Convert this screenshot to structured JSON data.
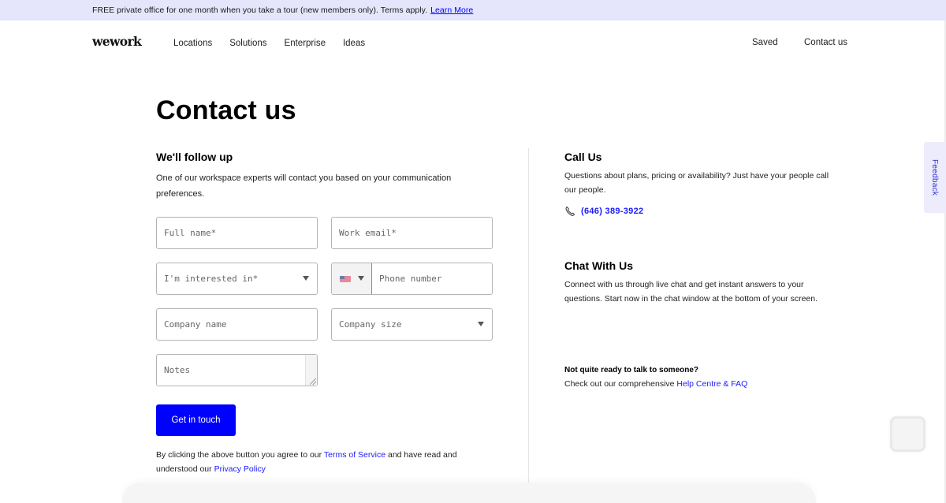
{
  "promo": {
    "text": "FREE private office for one month when you take a tour (new members only). Terms apply.",
    "link_label": "Learn More"
  },
  "nav": {
    "logo": "wework",
    "links": [
      {
        "label": "Locations"
      },
      {
        "label": "Solutions"
      },
      {
        "label": "Enterprise"
      },
      {
        "label": "Ideas"
      }
    ],
    "saved_label": "Saved",
    "contact_label": "Contact us"
  },
  "page": {
    "title": "Contact us"
  },
  "form": {
    "heading": "We'll follow up",
    "description": "One of our workspace experts will contact you based on your communication preferences.",
    "fields": {
      "full_name": {
        "placeholder": "Full name*",
        "value": ""
      },
      "work_email": {
        "placeholder": "Work email*",
        "value": ""
      },
      "interested_in": {
        "placeholder": "I'm interested in*",
        "selected": ""
      },
      "country_code": {
        "selected": "US"
      },
      "phone": {
        "placeholder": "Phone number",
        "value": ""
      },
      "company_name": {
        "placeholder": "Company name",
        "value": ""
      },
      "company_size": {
        "placeholder": "Company size",
        "selected": ""
      },
      "notes": {
        "placeholder": "Notes",
        "value": ""
      }
    },
    "submit_label": "Get in touch",
    "legal": {
      "prefix": "By clicking the above button you agree to our",
      "terms_label": "Terms of Service",
      "middle": "and have read and understood our",
      "privacy_label": "Privacy Policy"
    }
  },
  "call": {
    "heading": "Call Us",
    "description": "Questions about plans, pricing or availability? Just have your people call our people.",
    "phone": "(646) 389-3922",
    "icon": "phone-icon"
  },
  "chat": {
    "heading": "Chat With Us",
    "description": "Connect with us through live chat and get instant answers to your questions. Start now in the chat window at the bottom of your screen."
  },
  "help": {
    "heading": "Not quite ready to talk to someone?",
    "prefix": "Check out our comprehensive",
    "link_label": "Help Centre & FAQ"
  },
  "feedback": {
    "label": "Feedback"
  },
  "colors": {
    "brand_blue": "#0000ff",
    "link_blue": "#1a1aff",
    "promo_bg": "#e5e6fb"
  }
}
